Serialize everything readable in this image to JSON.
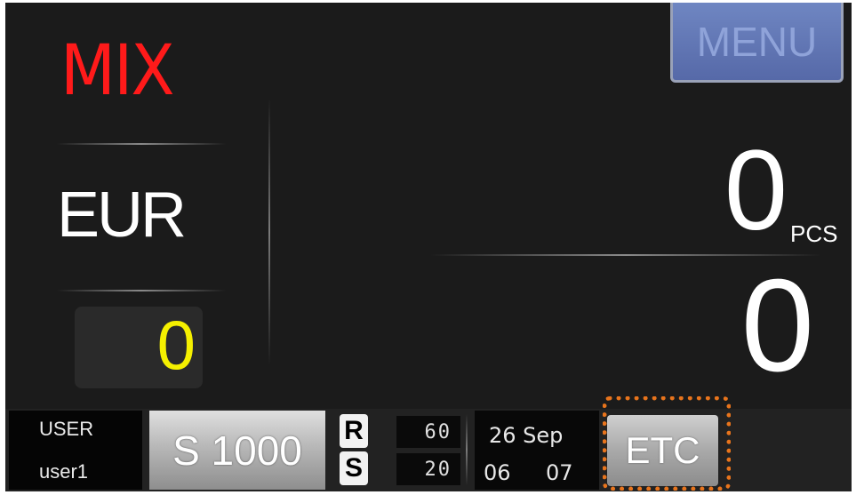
{
  "mode": {
    "label": "MIX",
    "color": "#ff1a1a"
  },
  "currency": {
    "code": "EUR"
  },
  "sub_counter": {
    "value": "0",
    "color": "#f5f000"
  },
  "menu_button": {
    "label": "MENU"
  },
  "pieces": {
    "count": "0",
    "unit": "PCS"
  },
  "amount": {
    "value": "0"
  },
  "status_bar": {
    "user": {
      "label": "USER",
      "value": "user1"
    },
    "model": "S 1000",
    "r_label": "R",
    "r_value": "60",
    "s_label": "S",
    "s_value": "20",
    "date": {
      "day_month": "26 Sep",
      "time_left": "06",
      "time_right": "07"
    },
    "etc_button": {
      "label": "ETC"
    }
  },
  "highlight": {
    "target": "etc_button",
    "color": "#e8741c"
  }
}
